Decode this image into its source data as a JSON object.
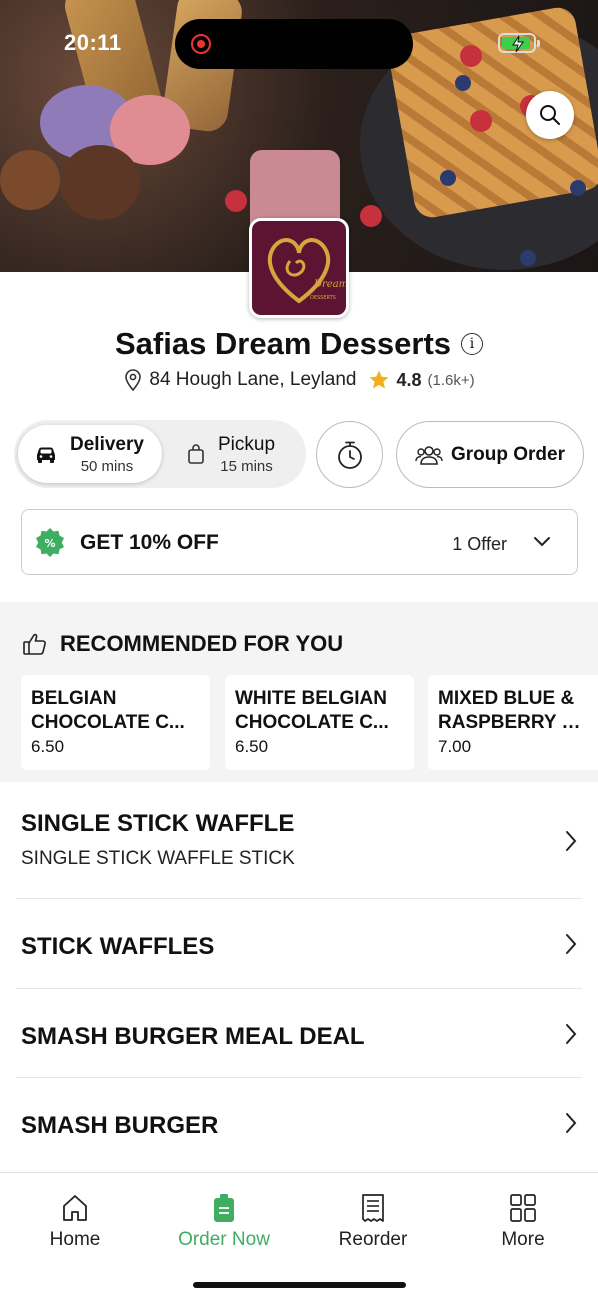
{
  "status": {
    "time": "20:11"
  },
  "store": {
    "name": "Safias Dream Desserts",
    "address": "84 Hough Lane, Leyland",
    "rating": "4.8",
    "rating_count": "(1.6k+)",
    "logo_text": "Safia's Dream Desserts"
  },
  "modes": {
    "delivery": {
      "label": "Delivery",
      "time": "50 mins",
      "selected": true
    },
    "pickup": {
      "label": "Pickup",
      "time": "15 mins",
      "selected": false
    }
  },
  "group_order_label": "Group Order",
  "offer": {
    "title": "GET 10% OFF",
    "count": "1 Offer"
  },
  "recommended": {
    "heading": "RECOMMENDED FOR YOU",
    "items": [
      {
        "line1": "BELGIAN",
        "line2": "CHOCOLATE C...",
        "price": "6.50"
      },
      {
        "line1": "WHITE BELGIAN",
        "line2": "CHOCOLATE C...",
        "price": "6.50"
      },
      {
        "line1": "MIXED BLUE &",
        "line2": "RASPBERRY CR...",
        "price": "7.00"
      }
    ]
  },
  "categories": [
    {
      "name": "SINGLE STICK WAFFLE",
      "subtitle": "SINGLE STICK WAFFLE STICK"
    },
    {
      "name": "STICK WAFFLES",
      "subtitle": ""
    },
    {
      "name": "SMASH BURGER MEAL DEAL",
      "subtitle": ""
    },
    {
      "name": "SMASH BURGER",
      "subtitle": ""
    }
  ],
  "tabbar": {
    "items": [
      {
        "label": "Home",
        "icon": "home-icon"
      },
      {
        "label": "Order Now",
        "icon": "order-bag-icon",
        "active": true
      },
      {
        "label": "Reorder",
        "icon": "receipt-icon"
      },
      {
        "label": "More",
        "icon": "grid-icon"
      }
    ]
  },
  "colors": {
    "accent": "#3fae62",
    "logo_bg": "#5d1433",
    "star": "#f2b01e"
  }
}
